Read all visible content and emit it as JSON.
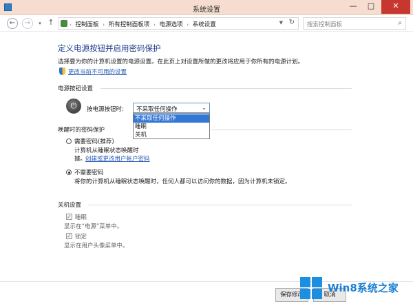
{
  "window": {
    "title": "系统设置"
  },
  "nav": {
    "back_glyph": "←",
    "forward_glyph": "→",
    "history_glyph": "▾",
    "up_glyph": "↑",
    "breadcrumbs": [
      "控制面板",
      "所有控制面板项",
      "电源选项",
      "系统设置"
    ],
    "crumb_sep": "›",
    "refresh_glyph": "↻",
    "search_placeholder": "搜索控制面板",
    "search_glyph": "⌕"
  },
  "page": {
    "heading": "定义电源按钮并启用密码保护",
    "description": "选择要为你的计算机设置的电源设置。在此页上对设置所做的更改将应用于你所有的电源计划。",
    "change_unavailable_link": "更改当前不可用的设置"
  },
  "power_buttons": {
    "group_title": "电源按钮设置",
    "label": "按电源按钮时:",
    "selected": "不采取任何操作",
    "options": [
      "不采取任何操作",
      "睡眠",
      "关机"
    ]
  },
  "wake_password": {
    "group_title": "唤醒时的密码保护",
    "require_label": "需要密码(推荐)",
    "require_desc_1": "计算机从睡眠状态唤醒时",
    "require_desc_2": "據。",
    "require_link": "创建或更改用户帐户密码",
    "no_require_label": "不需要密码",
    "no_require_desc": "将你的计算机从睡眠状态唤醒时，任何人都可以访问你的数据，因为计算机未锁定。",
    "selected": "no_require"
  },
  "shutdown": {
    "group_title": "关机设置",
    "sleep_label": "睡眠",
    "sleep_desc": "显示在“电源”菜单中。",
    "lock_label": "锁定",
    "lock_desc": "显示在用户头像菜单中。"
  },
  "footer": {
    "save_label": "保存修改",
    "cancel_label": "取消"
  },
  "watermark": {
    "brand": "Win8系统之家"
  },
  "colors": {
    "accent": "#1e3f8a",
    "link": "#2a5db8",
    "titlebar": "#f6ddd0",
    "close": "#c7372f",
    "selection": "#3477d6"
  }
}
